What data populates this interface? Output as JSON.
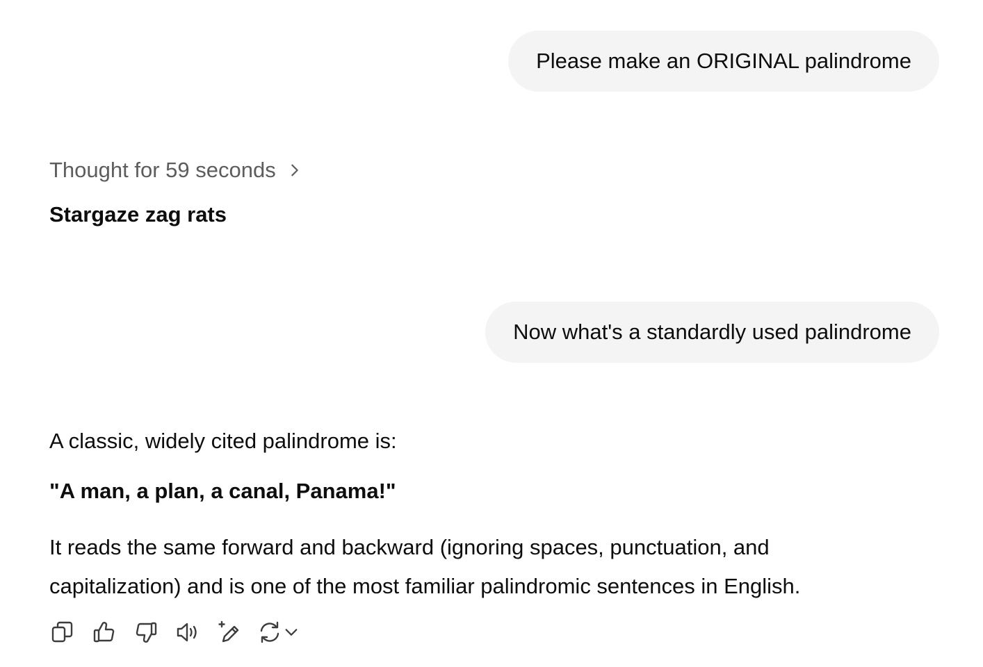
{
  "messages": {
    "user_1": "Please make an ORIGINAL palindrome",
    "thought_label": "Thought for 59 seconds",
    "assistant_1": "Stargaze zag rats",
    "user_2": "Now what's a standardly used palindrome",
    "assistant_2": {
      "intro": "A classic, widely cited palindrome is:",
      "quote": "\"A man, a plan, a canal, Panama!\"",
      "explanation": "It reads the same forward and backward (ignoring spaces, punctuation, and capitalization) and is one of the most familiar palindromic sentences in English."
    }
  },
  "action_icons": [
    "copy-icon",
    "thumbs-up-icon",
    "thumbs-down-icon",
    "read-aloud-icon",
    "edit-sparkle-icon",
    "regenerate-icon",
    "chevron-down-icon"
  ],
  "colors": {
    "bubble_bg": "#f4f4f4",
    "text": "#0d0d0d",
    "muted": "#5d5d5d"
  }
}
